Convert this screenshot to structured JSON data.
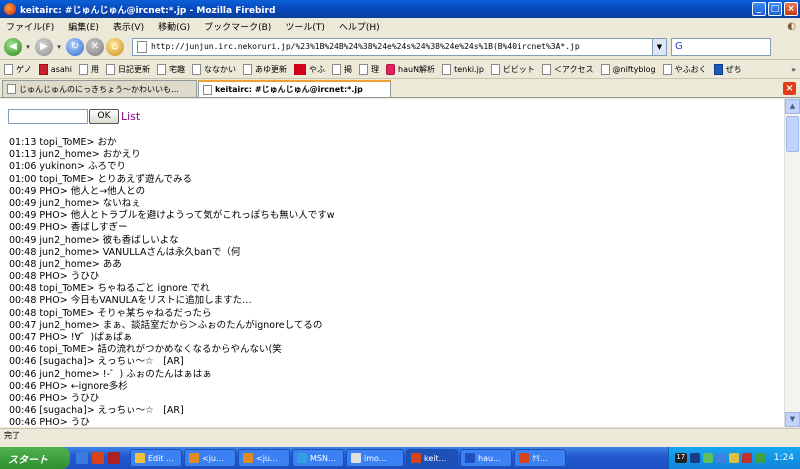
{
  "window": {
    "title": "keitairc: #じゅんじゅん@ircnet:*.jp - Mozilla Firebird"
  },
  "menubar": {
    "items": [
      "ファイル(F)",
      "編集(E)",
      "表示(V)",
      "移動(G)",
      "ブックマーク(B)",
      "ツール(T)",
      "ヘルプ(H)"
    ]
  },
  "navbar": {
    "url": "http://junjun.irc.nekoruri.jp/%23%1B%24B%24%38%24e%24s%24%38%24e%24s%1B(B%40ircnet%3A*.jp",
    "search_value": "G"
  },
  "bookmarks": {
    "items": [
      {
        "label": "ゲノ",
        "icon": "folder-icon"
      },
      {
        "label": "asahi",
        "icon": "asahi-icon"
      },
      {
        "label": "用",
        "icon": "folder-icon"
      },
      {
        "label": "日記更新",
        "icon": "folder-icon"
      },
      {
        "label": "宅趣",
        "icon": "folder-icon"
      },
      {
        "label": "ななかい",
        "icon": "folder-icon"
      },
      {
        "label": "あゆ更新",
        "icon": "folder-icon"
      },
      {
        "label": "やふ",
        "icon": "yahoo-icon"
      },
      {
        "label": "掲",
        "icon": "folder-icon"
      },
      {
        "label": "理",
        "icon": "folder-icon"
      },
      {
        "label": "hauN解析",
        "icon": "t-icon"
      },
      {
        "label": "tenki.jp",
        "icon": "folder-icon"
      },
      {
        "label": "ビビット",
        "icon": "folder-icon"
      },
      {
        "label": "＜アクセス",
        "icon": "folder-icon"
      },
      {
        "label": "@niftyblog",
        "icon": "folder-icon"
      },
      {
        "label": "やふおく",
        "icon": "folder-icon"
      },
      {
        "label": "ぜち",
        "icon": "d-icon"
      }
    ],
    "more": "»"
  },
  "tabs": [
    {
      "label": "じゅんじゅんのにっきちょう〜かわいいも…"
    },
    {
      "label": "keitairc: #じゅんじゅん@ircnet:*.jp"
    }
  ],
  "form": {
    "ok_label": "OK",
    "list_label": "List"
  },
  "log": [
    "01:13 topi_ToME> おか",
    "01:13 jun2_home> おかえり",
    "01:06 yukinon> ふろでり",
    "01:00 topi_ToME> とりあえず遊んでみる",
    "00:49 PHO> 他人と→他人との",
    "00:49 jun2_home> ないねぇ",
    "00:49 PHO> 他人とトラブルを避けようって気がこれっぽちも無い人ですw",
    "00:49 PHO> 香ばしすぎー",
    "00:49 jun2_home> 彼も香ばしいよな",
    "00:48 jun2_home> VANULLAさんは永久banで（何",
    "00:48 jun2_home> ああ",
    "00:48 PHO> うひひ",
    "00:48 topi_ToME> ちゃねるごと ignore でれ",
    "00:48 PHO> 今日もVANULAをリストに追加しますた…",
    "00:48 topi_ToME> そりゃ某ちゃねるだったら",
    "00:47 jun2_home> まぁ、談話室だから＞ふぉのたんがignoreしてるの",
    "00:47 PHO> !∀゜)ぱぁぱぁ",
    "00:46 topi_ToME> 話の流れがつかめなくなるからやんない(笑",
    "00:46 [sugacha]> えっちぃ〜☆　[AR]",
    "00:46 jun2_home> !-゜) ふぉのたんはぁはぁ",
    "00:46 PHO> ←ignore多杉",
    "00:46 PHO> うひひ",
    "00:46 [sugacha]> えっちぃ〜☆　[AR]",
    "00:46 PHO> うひ"
  ],
  "status": {
    "text": "完了"
  },
  "taskbar": {
    "start_label": "スタート",
    "buttons": [
      {
        "label": "Edit ..."
      },
      {
        "label": "<ju..."
      },
      {
        "label": "<ju..."
      },
      {
        "label": "MSN..."
      },
      {
        "label": "imo..."
      },
      {
        "label": "keit..."
      },
      {
        "label": "hau..."
      },
      {
        "label": "ｸﾘ..."
      }
    ],
    "clock": "1:24",
    "tray_number": "17"
  }
}
